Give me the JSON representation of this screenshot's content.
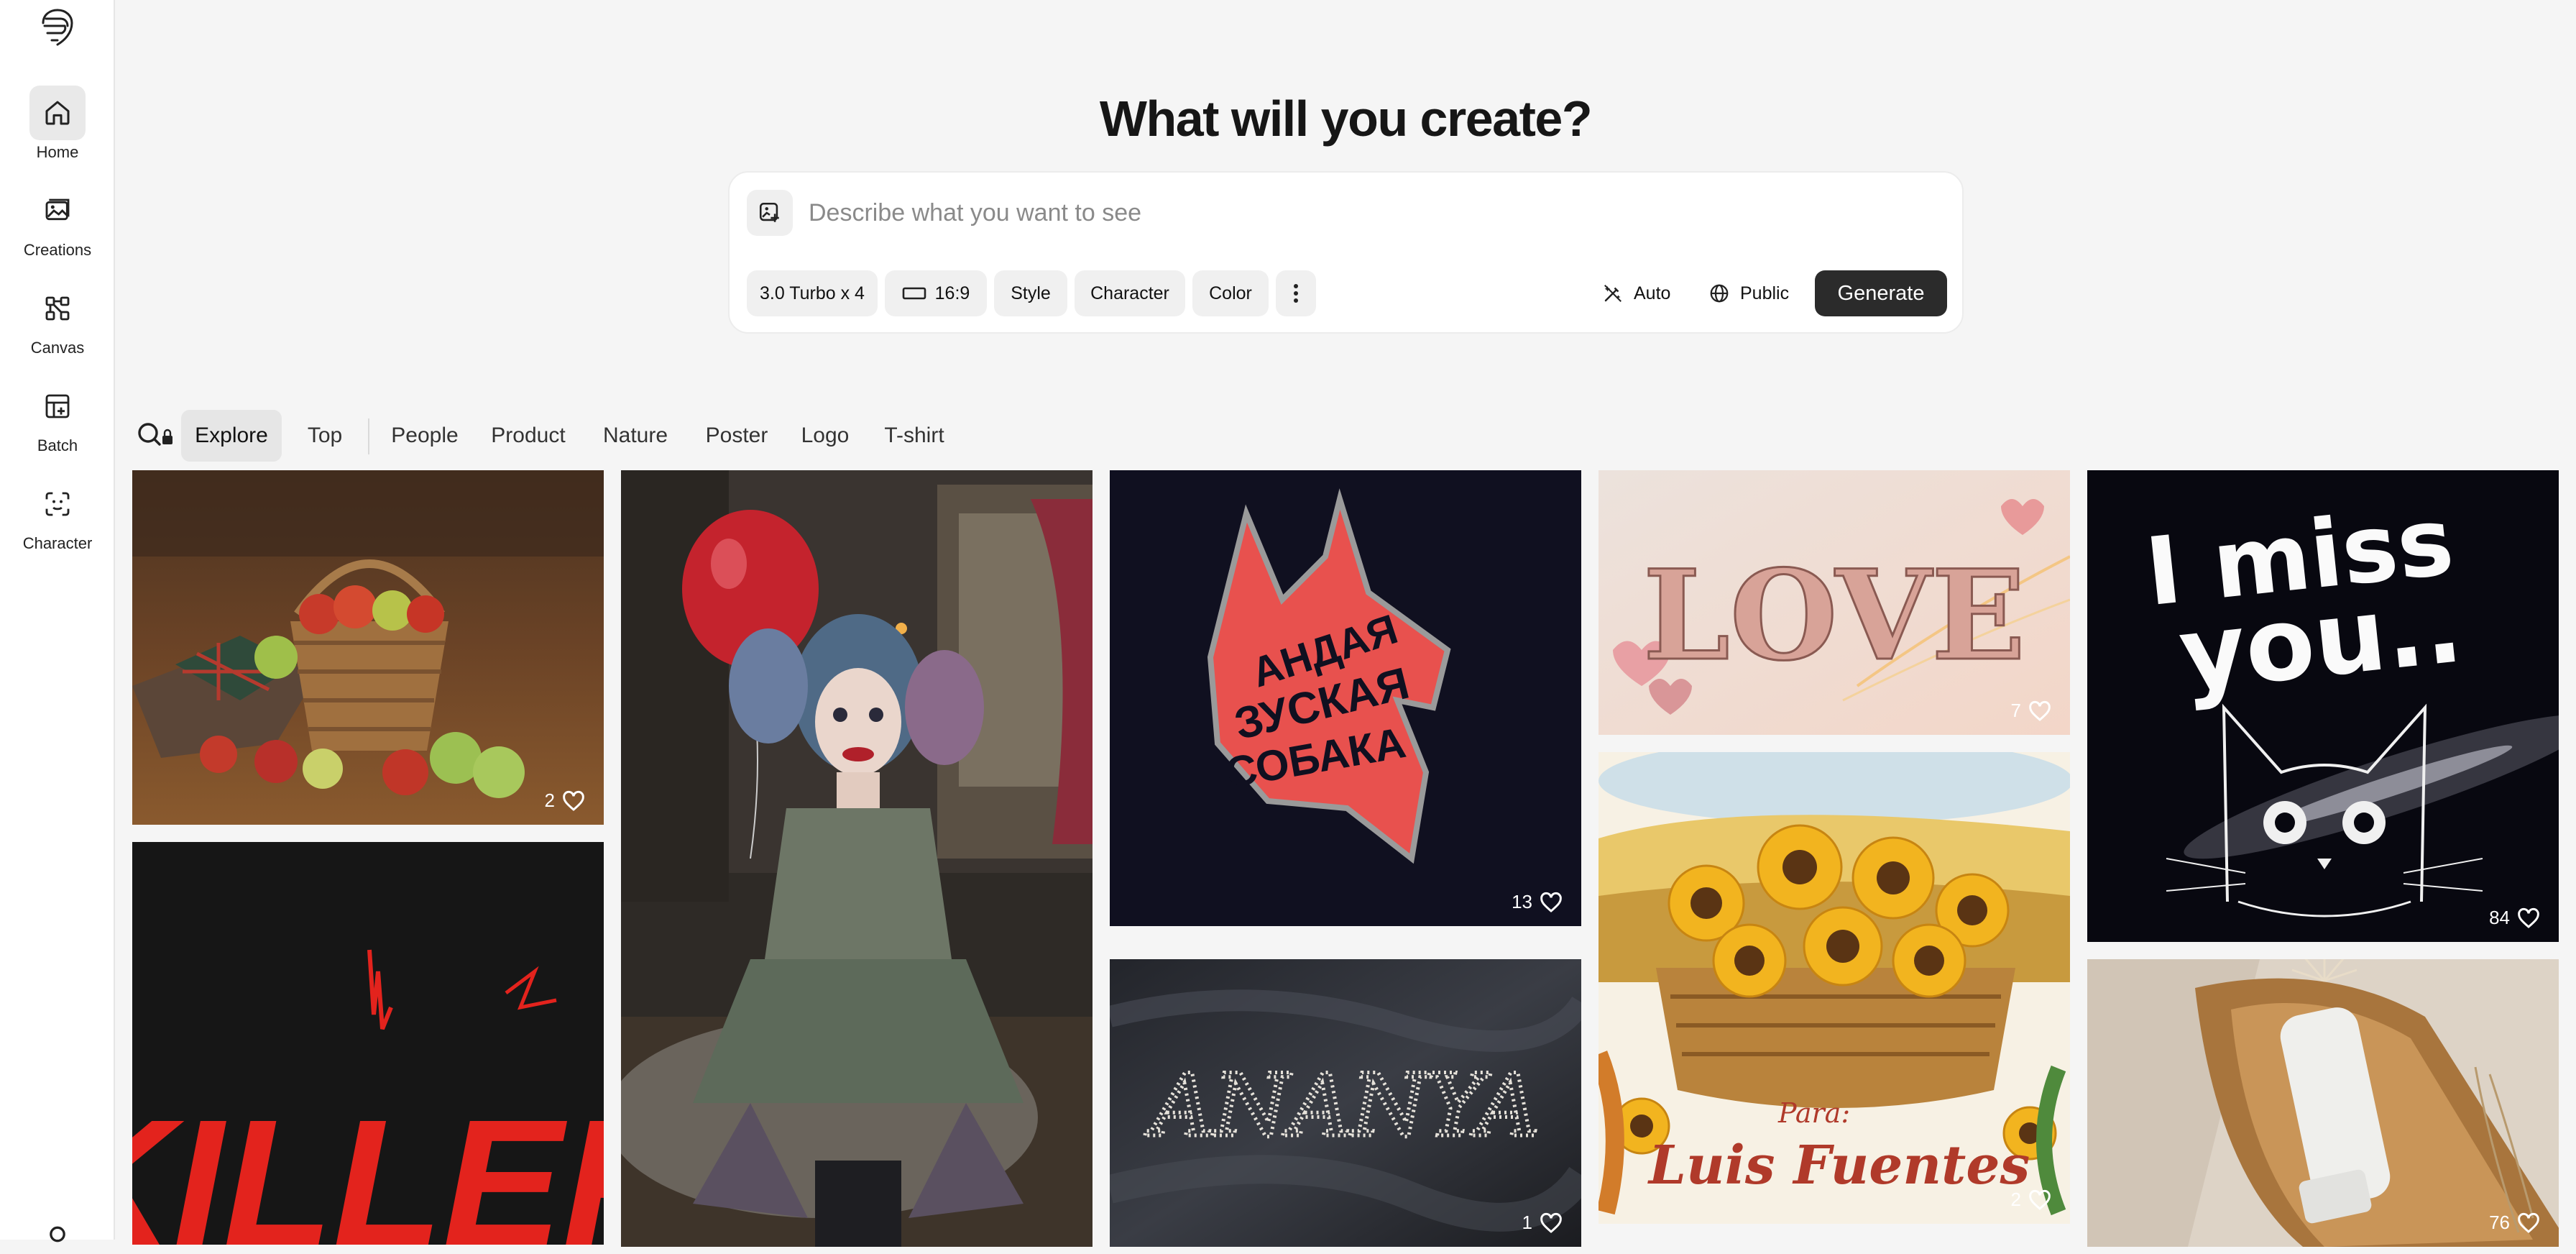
{
  "sidebar": {
    "items": [
      {
        "label": "Home",
        "icon": "home-icon"
      },
      {
        "label": "Creations",
        "icon": "image-stack-icon"
      },
      {
        "label": "Canvas",
        "icon": "canvas-nodes-icon"
      },
      {
        "label": "Batch",
        "icon": "batch-icon"
      },
      {
        "label": "Character",
        "icon": "face-scan-icon"
      }
    ]
  },
  "headline": "What will you create?",
  "prompt": {
    "placeholder": "Describe what you want to see",
    "model": "3.0 Turbo x 4",
    "aspect": "16:9",
    "style": "Style",
    "character": "Character",
    "color": "Color",
    "magic": "Auto",
    "visibility": "Public",
    "generate": "Generate"
  },
  "tabs": [
    "Explore",
    "Top",
    "People",
    "Product",
    "Nature",
    "Poster",
    "Logo",
    "T-shirt"
  ],
  "gallery": {
    "likes": {
      "apples": "2",
      "wolf": "13",
      "love": "7",
      "imiss": "84",
      "ananya": "1",
      "sunflower": "2",
      "lotion": "76"
    },
    "image_text": {
      "wolf_lines": [
        "АНДАЯ",
        "ЗУСКАЯ",
        "СОБАКА"
      ],
      "love": "LOVE",
      "imiss_1": "I miss",
      "imiss_2": "you..",
      "ananya": "ANANYA",
      "sunflower_1": "Para:",
      "sunflower_2": "Luis Fuentes",
      "killer": "KILLER"
    }
  },
  "colors": {
    "accent": "#2b2b2b",
    "active_tab": "#e6e6e6",
    "background": "#f5f5f5"
  }
}
